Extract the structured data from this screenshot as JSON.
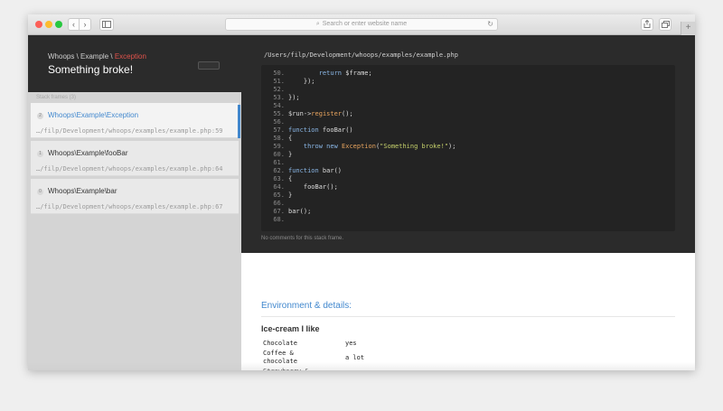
{
  "browser": {
    "address_placeholder": "Search or enter website name",
    "nav_back": "‹",
    "nav_forward": "›",
    "new_tab": "+"
  },
  "header": {
    "crumb_prefix": "Whoops \\ Example \\ ",
    "crumb_exception": "Exception",
    "title": "Something broke!"
  },
  "frames_label": "Stack frames (3)",
  "frames": [
    {
      "index": "2",
      "class": "Whoops\\Example\\Exception",
      "path": "…/filp/Development/whoops/examples/example.php:59"
    },
    {
      "index": "1",
      "class": "Whoops\\Example\\fooBar",
      "path": "…/filp/Development/whoops/examples/example.php:64"
    },
    {
      "index": "0",
      "class": "Whoops\\Example\\bar",
      "path": "…/filp/Development/whoops/examples/example.php:67"
    }
  ],
  "code": {
    "file_path": "/Users/filp/Development/whoops/examples/example.php",
    "lines": [
      {
        "n": "50.",
        "text": "        return $frame;"
      },
      {
        "n": "51.",
        "text": "    });"
      },
      {
        "n": "52.",
        "text": ""
      },
      {
        "n": "53.",
        "text": "});"
      },
      {
        "n": "54.",
        "text": ""
      },
      {
        "n": "55.",
        "text": "$run->register();"
      },
      {
        "n": "56.",
        "text": ""
      },
      {
        "n": "57.",
        "text": "function fooBar()"
      },
      {
        "n": "58.",
        "text": "{"
      },
      {
        "n": "59.",
        "text": "    throw new Exception(\"Something broke!\");"
      },
      {
        "n": "60.",
        "text": "}"
      },
      {
        "n": "61.",
        "text": ""
      },
      {
        "n": "62.",
        "text": "function bar()"
      },
      {
        "n": "63.",
        "text": "{"
      },
      {
        "n": "64.",
        "text": "    fooBar();"
      },
      {
        "n": "65.",
        "text": "}"
      },
      {
        "n": "66.",
        "text": ""
      },
      {
        "n": "67.",
        "text": "bar();"
      },
      {
        "n": "68.",
        "text": ""
      }
    ],
    "no_comments": "No comments for this stack frame."
  },
  "environment": {
    "title": "Environment & details:",
    "section": "Ice-cream I like",
    "rows": [
      {
        "key": "Chocolate",
        "value": "yes"
      },
      {
        "key": "Coffee & chocolate",
        "value": "a lot"
      },
      {
        "key": "Strawberry &",
        "value": ""
      }
    ]
  },
  "colors": {
    "accent": "#4288ce",
    "exception": "#e0524b",
    "dark_bg": "#2b2b2b"
  }
}
